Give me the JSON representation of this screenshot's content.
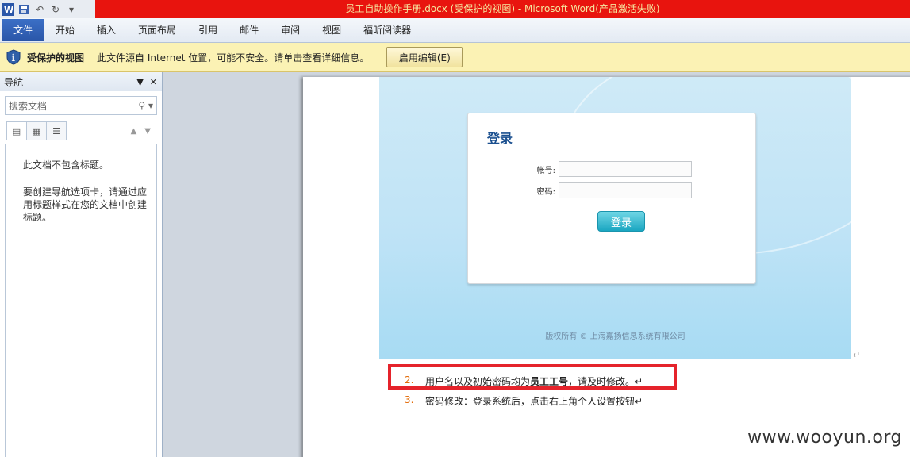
{
  "window": {
    "title": "员工自助操作手册.docx (受保护的视图) - Microsoft Word(产品激活失败)",
    "qat_icons": [
      "word-app-icon",
      "save-icon",
      "undo-icon",
      "redo-icon",
      "customize-qat-icon"
    ]
  },
  "ribbon": {
    "tabs": [
      "文件",
      "开始",
      "插入",
      "页面布局",
      "引用",
      "邮件",
      "审阅",
      "视图",
      "福昕阅读器"
    ]
  },
  "protected_bar": {
    "title": "受保护的视图",
    "message": "此文件源自 Internet 位置，可能不安全。请单击查看详细信息。",
    "enable_button": "启用编辑(E)"
  },
  "nav": {
    "title": "导航",
    "search_placeholder": "搜索文档",
    "empty_line1": "此文档不包含标题。",
    "empty_line2": "要创建导航选项卡，请通过应用标题样式在您的文档中创建标题。"
  },
  "doc": {
    "login": {
      "title": "登录",
      "account_label": "帐号:",
      "password_label": "密码:",
      "button": "登录",
      "footer": "版权所有 © 上海嘉扬信息系统有限公司"
    },
    "items": [
      {
        "num": "2.",
        "text_before": "用户名以及初始密码均为",
        "bold": "员工工号",
        "text_after": "，请及时修改。↵"
      },
      {
        "num": "3.",
        "text": "密码修改：登录系统后，点击右上角个人设置按钮↵"
      }
    ],
    "para_mark": "↵"
  },
  "watermark": "www.wooyun.org",
  "colors": {
    "title_red": "#e8140e",
    "protected_bar": "#fbf2b4",
    "file_tab": "#2a56a8",
    "highlight_box": "#e5232b"
  }
}
